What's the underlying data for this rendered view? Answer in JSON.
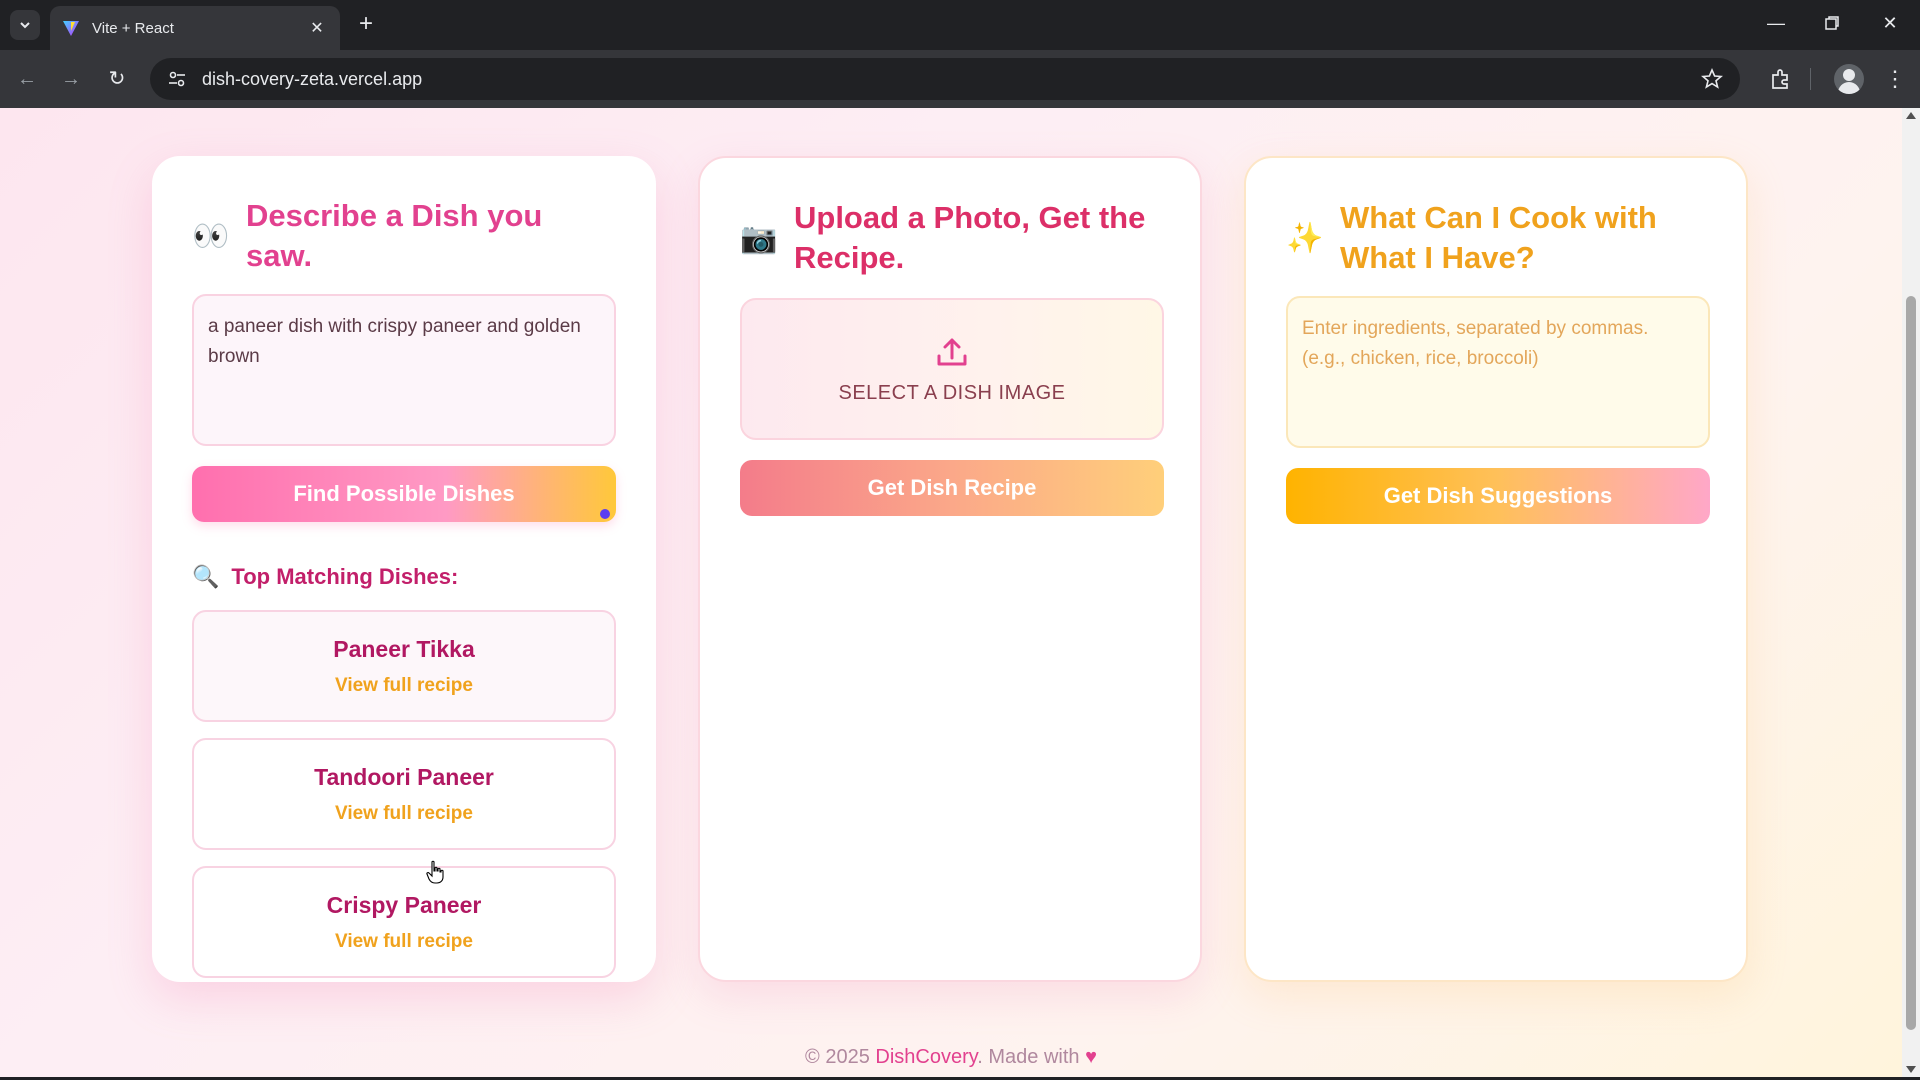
{
  "browser": {
    "tab_title": "Vite + React",
    "tab_close_icon": "close-icon",
    "new_tab_icon": "plus-icon",
    "url": "dish-covery-zeta.vercel.app",
    "window_controls": [
      "minimize-icon",
      "restore-icon",
      "close-icon"
    ]
  },
  "describe": {
    "emoji": "👀",
    "title": "Describe a Dish you saw.",
    "input_value": "a paneer dish with crispy paneer and golden brown",
    "button_label": "Find Possible Dishes",
    "matches_icon": "🔍",
    "matches_title": "Top Matching Dishes:",
    "dishes": [
      {
        "name": "Paneer Tikka",
        "link": "View full recipe"
      },
      {
        "name": "Tandoori Paneer",
        "link": "View full recipe"
      },
      {
        "name": "Crispy Paneer",
        "link": "View full recipe"
      }
    ]
  },
  "upload": {
    "emoji": "📷",
    "title": "Upload a Photo, Get the Recipe.",
    "dropzone_label": "SELECT A DISH IMAGE",
    "button_label": "Get Dish Recipe"
  },
  "cook": {
    "emoji": "✨",
    "title": "What Can I Cook with What I Have?",
    "input_placeholder": "Enter ingredients, separated by commas. (e.g., chicken, rice, broccoli)",
    "button_label": "Get Dish Suggestions"
  },
  "footer": {
    "prefix": "© 2025 ",
    "brand": "DishCovery",
    "suffix": ". Made with ",
    "heart": "♥"
  },
  "colors": {
    "pink": "#e2418f",
    "red": "#dc2f68",
    "orange": "#f0a21d",
    "dish_name": "#b11862"
  }
}
